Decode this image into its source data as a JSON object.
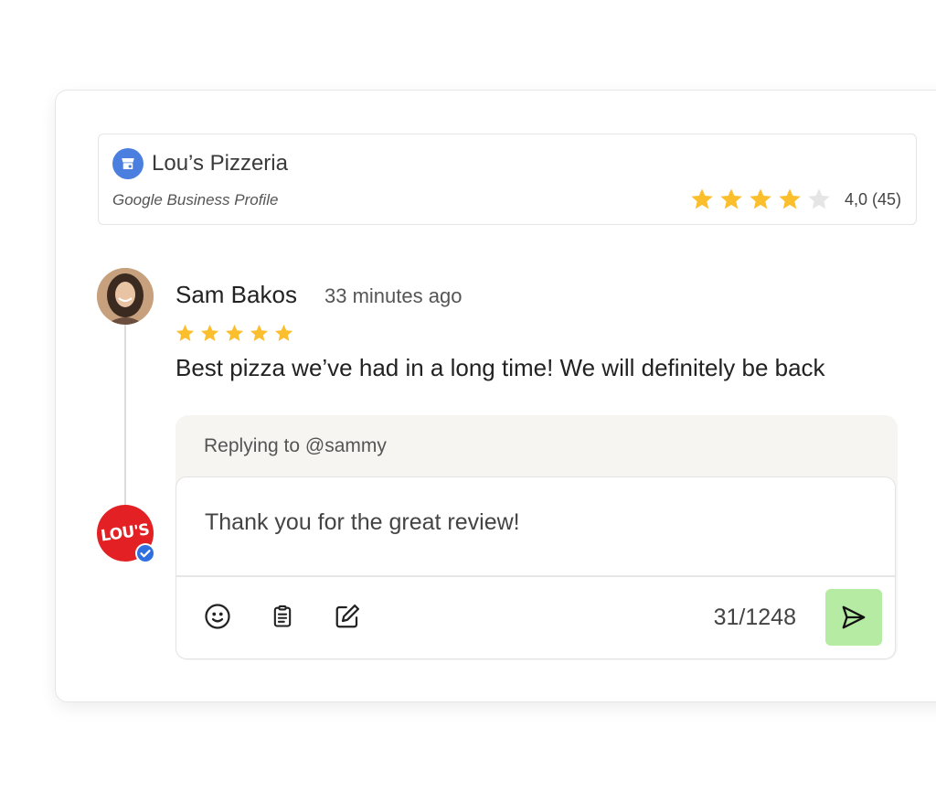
{
  "business": {
    "name": "Lou’s Pizzeria",
    "source": "Google Business Profile",
    "rating_value": 4.0,
    "stars_filled": 4,
    "stars_total": 5,
    "rating_label": "4,0 (45)",
    "icon": "storefront-icon",
    "icon_color": "#4a7fe0"
  },
  "review": {
    "author": "Sam Bakos",
    "time": "33 minutes ago",
    "stars_filled": 5,
    "text": "Best pizza we’ve had in a long time! We will definitely be back"
  },
  "reply": {
    "replying_to": "Replying to @sammy",
    "value": "Thank you for the great review!",
    "counter": "31/1248",
    "brand_logo_text": "LOU'S",
    "brand_color": "#e32023",
    "send_color": "#b6eba3",
    "tools": [
      "emoji-icon",
      "clipboard-icon",
      "edit-icon"
    ]
  },
  "colors": {
    "star": "#fbbf2e",
    "star_empty": "#e5e5e5",
    "verified": "#2f6fe0"
  }
}
